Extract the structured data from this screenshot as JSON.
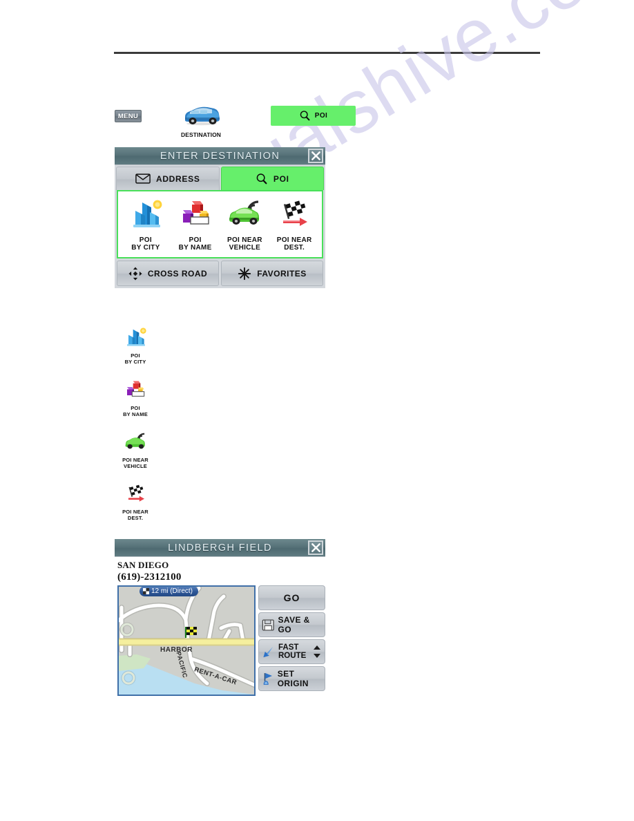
{
  "watermark": {
    "text": "manualshive.com"
  },
  "toolbar": {
    "menu_label": "MENU",
    "destination_label": "DESTINATION",
    "destination_icon": "blue-suv-icon",
    "poi_button_label": "POI",
    "poi_button_icon": "magnifier-icon",
    "poi_button_color": "#66EF6B"
  },
  "enter_destination": {
    "title": "ENTER DESTINATION",
    "close_icon": "close-x-icon",
    "tabs": [
      {
        "label": "ADDRESS",
        "icon": "envelope-icon",
        "active": false
      },
      {
        "label": "POI",
        "icon": "magnifier-icon",
        "active": true
      }
    ],
    "poi_options": [
      {
        "line1": "POI",
        "line2": "BY CITY",
        "icon": "city-skyline-icon"
      },
      {
        "line1": "POI",
        "line2": "BY NAME",
        "icon": "colored-blocks-icon"
      },
      {
        "line1": "POI NEAR",
        "line2": "VEHICLE",
        "icon": "green-car-signal-icon"
      },
      {
        "line1": "POI NEAR",
        "line2": "DEST.",
        "icon": "checkered-flag-icon"
      }
    ],
    "bottom_buttons": [
      {
        "label": "CROSS ROAD",
        "icon": "crossroad-arrows-icon"
      },
      {
        "label": "FAVORITES",
        "icon": "starburst-icon"
      }
    ],
    "accent_color": "#49E05A",
    "title_bar_color": "#577279"
  },
  "legend": [
    {
      "line1": "POI",
      "line2": "BY CITY",
      "icon": "city-skyline-icon"
    },
    {
      "line1": "POI",
      "line2": "BY NAME",
      "icon": "colored-blocks-icon"
    },
    {
      "line1": "POI NEAR",
      "line2": "VEHICLE",
      "icon": "green-car-signal-icon"
    },
    {
      "line1": "POI NEAR",
      "line2": "DEST.",
      "icon": "checkered-flag-icon"
    }
  ],
  "detail_panel": {
    "title": "LINDBERGH FIELD",
    "close_icon": "close-x-icon",
    "city": "SAN DIEGO",
    "phone": "(619)-2312100",
    "map": {
      "distance_badge": "12 mi (Direct)",
      "distance_badge_icon": "checkered-flag-small-icon",
      "street_labels": [
        "HARBOR",
        "PACIFIC HWY",
        "RENT-A-CAR"
      ],
      "destination_marker_icon": "checkered-flag-marker-icon"
    },
    "actions": [
      {
        "label": "GO",
        "icon": ""
      },
      {
        "label": "SAVE & GO",
        "icon": "floppy-disk-icon"
      },
      {
        "label_line1": "FAST",
        "label_line2": "ROUTE",
        "icon": "blue-arrow-icon",
        "has_spinner": true
      },
      {
        "label": "SET ORIGIN",
        "icon": "blue-flag-pin-icon"
      }
    ]
  }
}
